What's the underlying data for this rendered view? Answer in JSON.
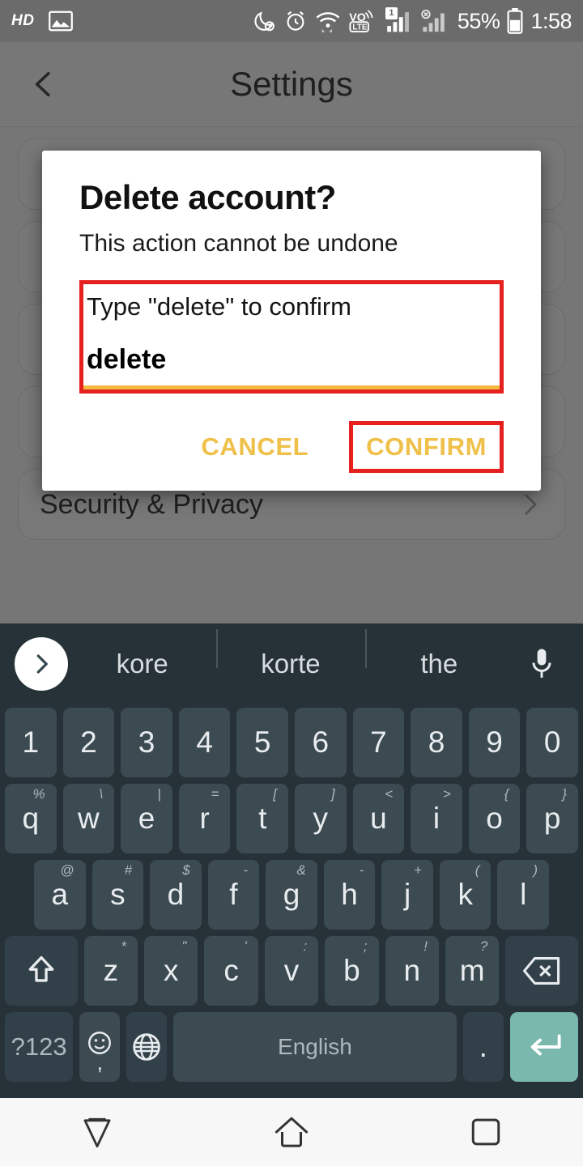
{
  "status_bar": {
    "hd_label": "HD",
    "battery_percent": "55%",
    "clock": "1:58",
    "sim_badge": "1",
    "icons": [
      "hd-label",
      "screenshot-image-icon",
      "do-not-disturb-moon-icon",
      "alarm-clock-icon",
      "wifi-icon",
      "volte-icon",
      "signal-bars-sim1-icon",
      "signal-bars-sim2-disabled-icon",
      "battery-icon"
    ]
  },
  "app": {
    "title": "Settings",
    "back_label": "",
    "rows": [
      {
        "label": ""
      },
      {
        "label": ""
      },
      {
        "label": ""
      },
      {
        "label": ""
      },
      {
        "label": "Security & Privacy"
      }
    ]
  },
  "dialog": {
    "title": "Delete account?",
    "subtitle": "This action cannot be undone",
    "field": {
      "label": "Type \"delete\" to confirm",
      "value": "delete",
      "placeholder": "Type \"delete\" to confirm"
    },
    "cancel_label": "CANCEL",
    "confirm_label": "CONFIRM",
    "accent_color": "#efc14a",
    "highlight_color": "#e5201f",
    "underline_color": "#f3ba3f"
  },
  "keyboard": {
    "suggestions": [
      "kore",
      "korte",
      "the"
    ],
    "expand_icon": "chevron-right-icon",
    "mic_icon": "microphone-icon",
    "rows": {
      "numbers": [
        {
          "key": "1"
        },
        {
          "key": "2"
        },
        {
          "key": "3"
        },
        {
          "key": "4"
        },
        {
          "key": "5"
        },
        {
          "key": "6"
        },
        {
          "key": "7"
        },
        {
          "key": "8"
        },
        {
          "key": "9"
        },
        {
          "key": "0"
        }
      ],
      "top": [
        {
          "key": "q",
          "alt": "%"
        },
        {
          "key": "w",
          "alt": "\\"
        },
        {
          "key": "e",
          "alt": "|"
        },
        {
          "key": "r",
          "alt": "="
        },
        {
          "key": "t",
          "alt": "["
        },
        {
          "key": "y",
          "alt": "]"
        },
        {
          "key": "u",
          "alt": "<"
        },
        {
          "key": "i",
          "alt": ">"
        },
        {
          "key": "o",
          "alt": "{"
        },
        {
          "key": "p",
          "alt": "}"
        }
      ],
      "home": [
        {
          "key": "a",
          "alt": "@"
        },
        {
          "key": "s",
          "alt": "#"
        },
        {
          "key": "d",
          "alt": "$"
        },
        {
          "key": "f",
          "alt": "-"
        },
        {
          "key": "g",
          "alt": "&"
        },
        {
          "key": "h",
          "alt": "-"
        },
        {
          "key": "j",
          "alt": "+"
        },
        {
          "key": "k",
          "alt": "("
        },
        {
          "key": "l",
          "alt": ")"
        }
      ],
      "bottom": [
        {
          "key": "z",
          "alt": "*"
        },
        {
          "key": "x",
          "alt": "\""
        },
        {
          "key": "c",
          "alt": "'"
        },
        {
          "key": "v",
          "alt": ":"
        },
        {
          "key": "b",
          "alt": ";"
        },
        {
          "key": "n",
          "alt": "!"
        },
        {
          "key": "m",
          "alt": "?"
        }
      ]
    },
    "shift_icon": "shift-arrow-up-icon",
    "backspace_icon": "backspace-icon",
    "symbols_label": "?123",
    "emoji_icon": "emoji-smiley-icon",
    "emoji_sub_label": ",",
    "globe_icon": "globe-language-icon",
    "space_label": "English",
    "period_label": ".",
    "enter_icon": "enter-return-icon",
    "enter_color": "#7ab8ae",
    "background_color": "#263238",
    "key_color": "#3c4a52"
  },
  "nav_bar": {
    "back_icon": "nav-back-triangle-icon",
    "home_icon": "nav-home-icon",
    "recents_icon": "nav-recents-icon"
  }
}
